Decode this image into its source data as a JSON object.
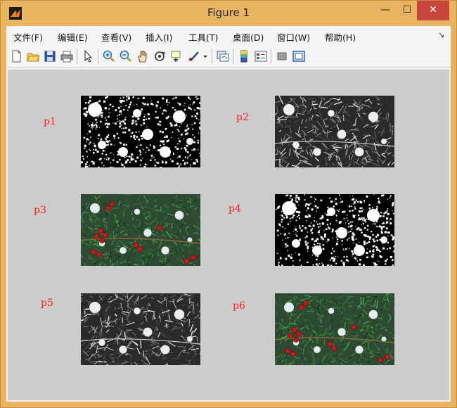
{
  "window": {
    "title": "Figure 1"
  },
  "window_buttons": {
    "minimize": "—",
    "maximize": "☐",
    "close": "✕"
  },
  "menu": [
    {
      "label": "文件(F)"
    },
    {
      "label": "编辑(E)"
    },
    {
      "label": "查看(V)"
    },
    {
      "label": "插入(I)"
    },
    {
      "label": "工具(T)"
    },
    {
      "label": "桌面(D)"
    },
    {
      "label": "窗口(W)"
    },
    {
      "label": "帮助(H)"
    }
  ],
  "toolbar": [
    {
      "icon": "new-figure-icon"
    },
    {
      "icon": "open-file-icon"
    },
    {
      "icon": "save-icon"
    },
    {
      "icon": "print-icon"
    },
    {
      "icon": "edit-plot-arrow-icon"
    },
    {
      "icon": "zoom-in-icon"
    },
    {
      "icon": "zoom-out-icon"
    },
    {
      "icon": "pan-hand-icon"
    },
    {
      "icon": "rotate-3d-icon"
    },
    {
      "icon": "data-cursor-icon"
    },
    {
      "icon": "brush-icon"
    },
    {
      "icon": "brush-dropdown-icon"
    },
    {
      "icon": "link-plot-icon"
    },
    {
      "icon": "colorbar-icon"
    },
    {
      "icon": "legend-icon"
    },
    {
      "icon": "hide-plot-tools-icon"
    },
    {
      "icon": "show-plot-tools-icon"
    }
  ],
  "panels": [
    {
      "label": "p1",
      "kind": "binary"
    },
    {
      "label": "p2",
      "kind": "gray"
    },
    {
      "label": "p3",
      "kind": "color"
    },
    {
      "label": "p4",
      "kind": "binary"
    },
    {
      "label": "p5",
      "kind": "gray"
    },
    {
      "label": "p6",
      "kind": "color"
    }
  ],
  "colors": {
    "window_frame": "#e9b45f",
    "close_button": "#c7463d",
    "figure_background": "#cccccc",
    "panel_label": "#ff2020",
    "berry_red": "#c0181c",
    "foliage_green": "#2f4a32"
  }
}
